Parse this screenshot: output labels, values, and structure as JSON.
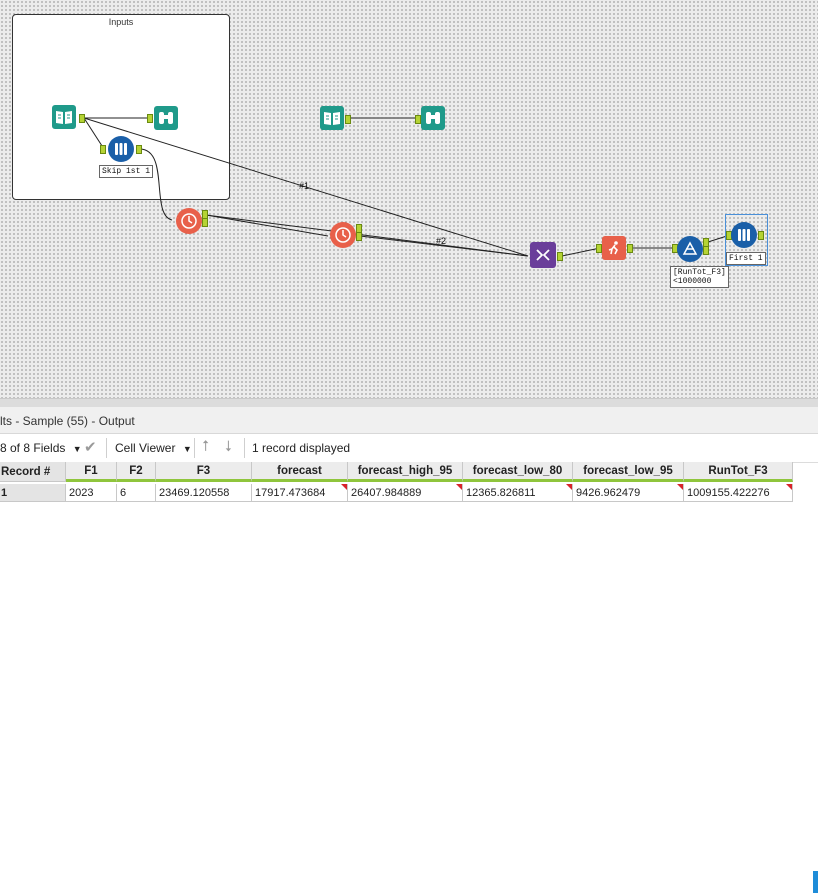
{
  "canvas": {
    "container_title": "Inputs",
    "labels": {
      "skip_tool": "Skip 1st 1",
      "filter_tool": "[RunTot_F3]\n<1000000",
      "first_tool": "First 1"
    },
    "connection_labels": [
      "#1",
      "#2"
    ]
  },
  "results": {
    "title": "lts - Sample (55) - Output",
    "toolbar": {
      "fields": "8 of 8 Fields",
      "viewer": "Cell Viewer",
      "status": "1 record displayed"
    },
    "columns": [
      "Record #",
      "F1",
      "F2",
      "F3",
      "forecast",
      "forecast_high_95",
      "forecast_low_80",
      "forecast_low_95",
      "RunTot_F3"
    ],
    "rows": [
      [
        "1",
        "2023",
        "6",
        "23469.120558",
        "17917.473684",
        "26407.984889",
        "12365.826811",
        "9426.962479",
        "1009155.422276"
      ]
    ]
  },
  "colors": {
    "input_tool": "#1f9a8a",
    "browse_tool": "#1f9a8a",
    "sample_tool": "#1a5fa8",
    "timeseries_tool": "#e8604a",
    "join_tool": "#6a3d9a",
    "runtotal_tool": "#e8604a",
    "filter_tool": "#1a5fa8",
    "anchor": "#b5d334"
  }
}
